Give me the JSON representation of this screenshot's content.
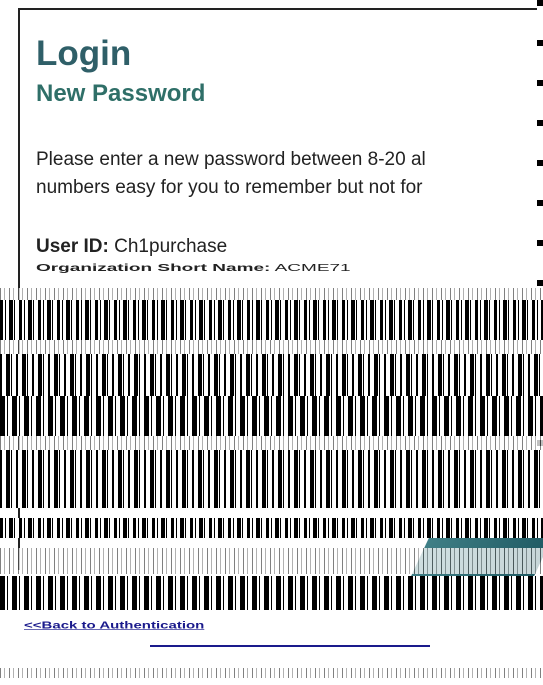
{
  "header": {
    "title": "Login",
    "subtitle": "New Password"
  },
  "instructions": {
    "line1": "Please enter a new password between 8-20 al",
    "line2": "numbers easy for you to remember but not for"
  },
  "account": {
    "user_id_label": "User ID:",
    "user_id_value": "Ch1purchase",
    "org_label": "Organization Short Name:",
    "org_value": "ACME71"
  },
  "links": {
    "back": "<<Back to Authentication"
  },
  "colors": {
    "title": "#2f5f68",
    "link": "#1a1a8c",
    "accent_band": "#3f7f86"
  }
}
